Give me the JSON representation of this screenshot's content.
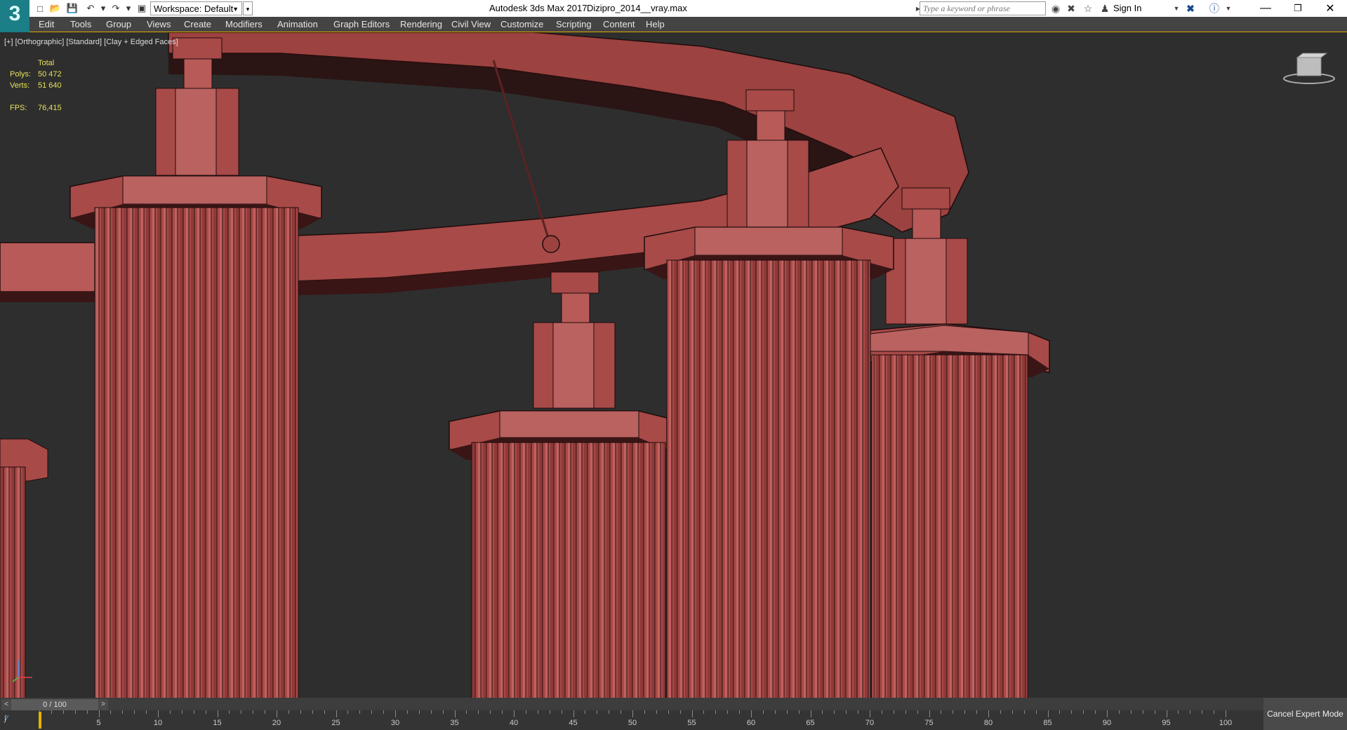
{
  "app": {
    "logo_text": "3",
    "title": "Autodesk 3ds Max 2017",
    "file": "Dizipro_2014__vray.max"
  },
  "quick_access": {
    "workspace_value": "Workspace: Default"
  },
  "search": {
    "placeholder": "Type a keyword or phrase"
  },
  "account": {
    "sign_in": "Sign In"
  },
  "menu": {
    "items": [
      "Edit",
      "Tools",
      "Group",
      "Views",
      "Create",
      "Modifiers",
      "Animation",
      "Graph Editors",
      "Rendering",
      "Civil View",
      "Customize",
      "Scripting",
      "Content",
      "Help"
    ]
  },
  "viewport": {
    "label": "[+] [Orthographic] [Standard] [Clay + Edged Faces]",
    "stats": {
      "header": "Total",
      "polys_label": "Polys:",
      "polys_value": "50 472",
      "verts_label": "Verts:",
      "verts_value": "51 640",
      "fps_label": "FPS:",
      "fps_value": "76,415"
    },
    "model_color": "#a84a48",
    "background_color": "#2e2e2e"
  },
  "timeline": {
    "slider_value": "0 / 100",
    "current_frame": 0,
    "range": [
      0,
      100
    ],
    "tick_labels": [
      "0",
      "5",
      "10",
      "15",
      "20",
      "25",
      "30",
      "35",
      "40",
      "45",
      "50",
      "55",
      "60",
      "65",
      "70",
      "75",
      "80",
      "85",
      "90",
      "95",
      "100"
    ]
  },
  "status": {
    "expert_mode": "Cancel Expert Mode"
  },
  "colors": {
    "accent": "#d9a900",
    "titlebar": "#ffffff",
    "menubar": "#444444"
  }
}
